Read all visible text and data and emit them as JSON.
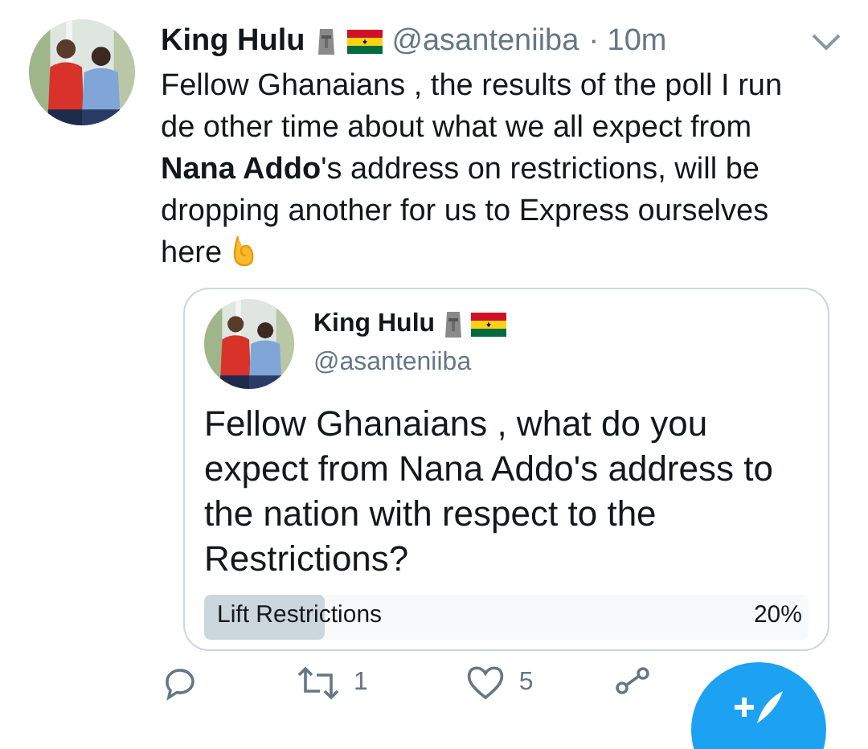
{
  "tweet": {
    "name": "King Hulu",
    "handle": "@asanteniiba",
    "time": "· 10m",
    "text": "Fellow Ghanaians , the results of the poll I run de other time about what we all expect from **Nana Addo**'s address on restrictions, will be dropping another for us to Express ourselves here"
  },
  "quoted": {
    "name": "King Hulu",
    "handle": "@asanteniiba",
    "text": "Fellow Ghanaians , what do you expect from Nana Addo's address to the nation with respect to the Restrictions?",
    "poll_options": [
      {
        "label": "Lift Restrictions",
        "percent": "20%",
        "level": 0.2
      }
    ]
  },
  "actions": {
    "retweets": "1",
    "likes": "5"
  }
}
